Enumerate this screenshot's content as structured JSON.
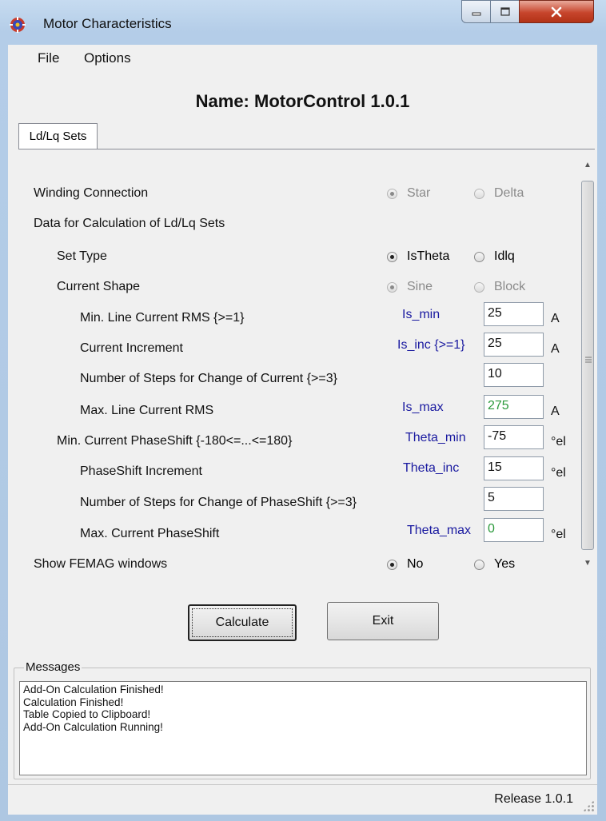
{
  "window": {
    "title": "Motor Characteristics",
    "app_icon": "motor-app-icon",
    "controls": [
      "minimize-icon",
      "maximize-icon",
      "close-icon"
    ]
  },
  "menu": {
    "file": "File",
    "options": "Options"
  },
  "header": {
    "name": "Name: MotorControl 1.0.1"
  },
  "tab": {
    "label": "Ld/Lq Sets"
  },
  "form": {
    "winding": {
      "label": "Winding Connection",
      "opt1": "Star",
      "opt2": "Delta",
      "selected": "Star"
    },
    "data_heading": "Data for Calculation of Ld/Lq Sets",
    "set_type": {
      "label": "Set Type",
      "opt1": "IsTheta",
      "opt2": "Idlq",
      "selected": "IsTheta"
    },
    "current_shape": {
      "label": "Current Shape",
      "opt1": "Sine",
      "opt2": "Block",
      "selected": "Sine"
    },
    "min_line_current": {
      "label": "Min. Line Current RMS {>=1}",
      "param": "Is_min",
      "value": "25",
      "unit": "A"
    },
    "current_increment": {
      "label": "Current Increment",
      "param": "Is_inc {>=1}",
      "value": "25",
      "unit": "A"
    },
    "steps_current": {
      "label": "Number of Steps for Change of Current {>=3}",
      "value": "10"
    },
    "max_line_current": {
      "label": "Max. Line Current RMS",
      "param": "Is_max",
      "value": "275",
      "unit": "A"
    },
    "min_phaseshift": {
      "label": "Min. Current PhaseShift {-180<=...<=180}",
      "param": "Theta_min",
      "value": "-75",
      "unit": "°el"
    },
    "phaseshift_increment": {
      "label": "PhaseShift Increment",
      "param": "Theta_inc",
      "value": "15",
      "unit": "°el"
    },
    "steps_phaseshift": {
      "label": "Number of Steps for Change of PhaseShift {>=3}",
      "value": "5"
    },
    "max_phaseshift": {
      "label": "Max. Current PhaseShift",
      "param": "Theta_max",
      "value": "0",
      "unit": "°el"
    },
    "femag": {
      "label": "Show FEMAG windows",
      "opt1": "No",
      "opt2": "Yes",
      "selected": "No"
    }
  },
  "buttons": {
    "calculate": "Calculate",
    "exit": "Exit"
  },
  "messages": {
    "legend": "Messages",
    "lines": [
      "Add-On Calculation Finished!",
      "Calculation Finished!",
      "Table Copied to Clipboard!",
      "Add-On Calculation Running!"
    ]
  },
  "status": {
    "release": "Release 1.0.1"
  }
}
